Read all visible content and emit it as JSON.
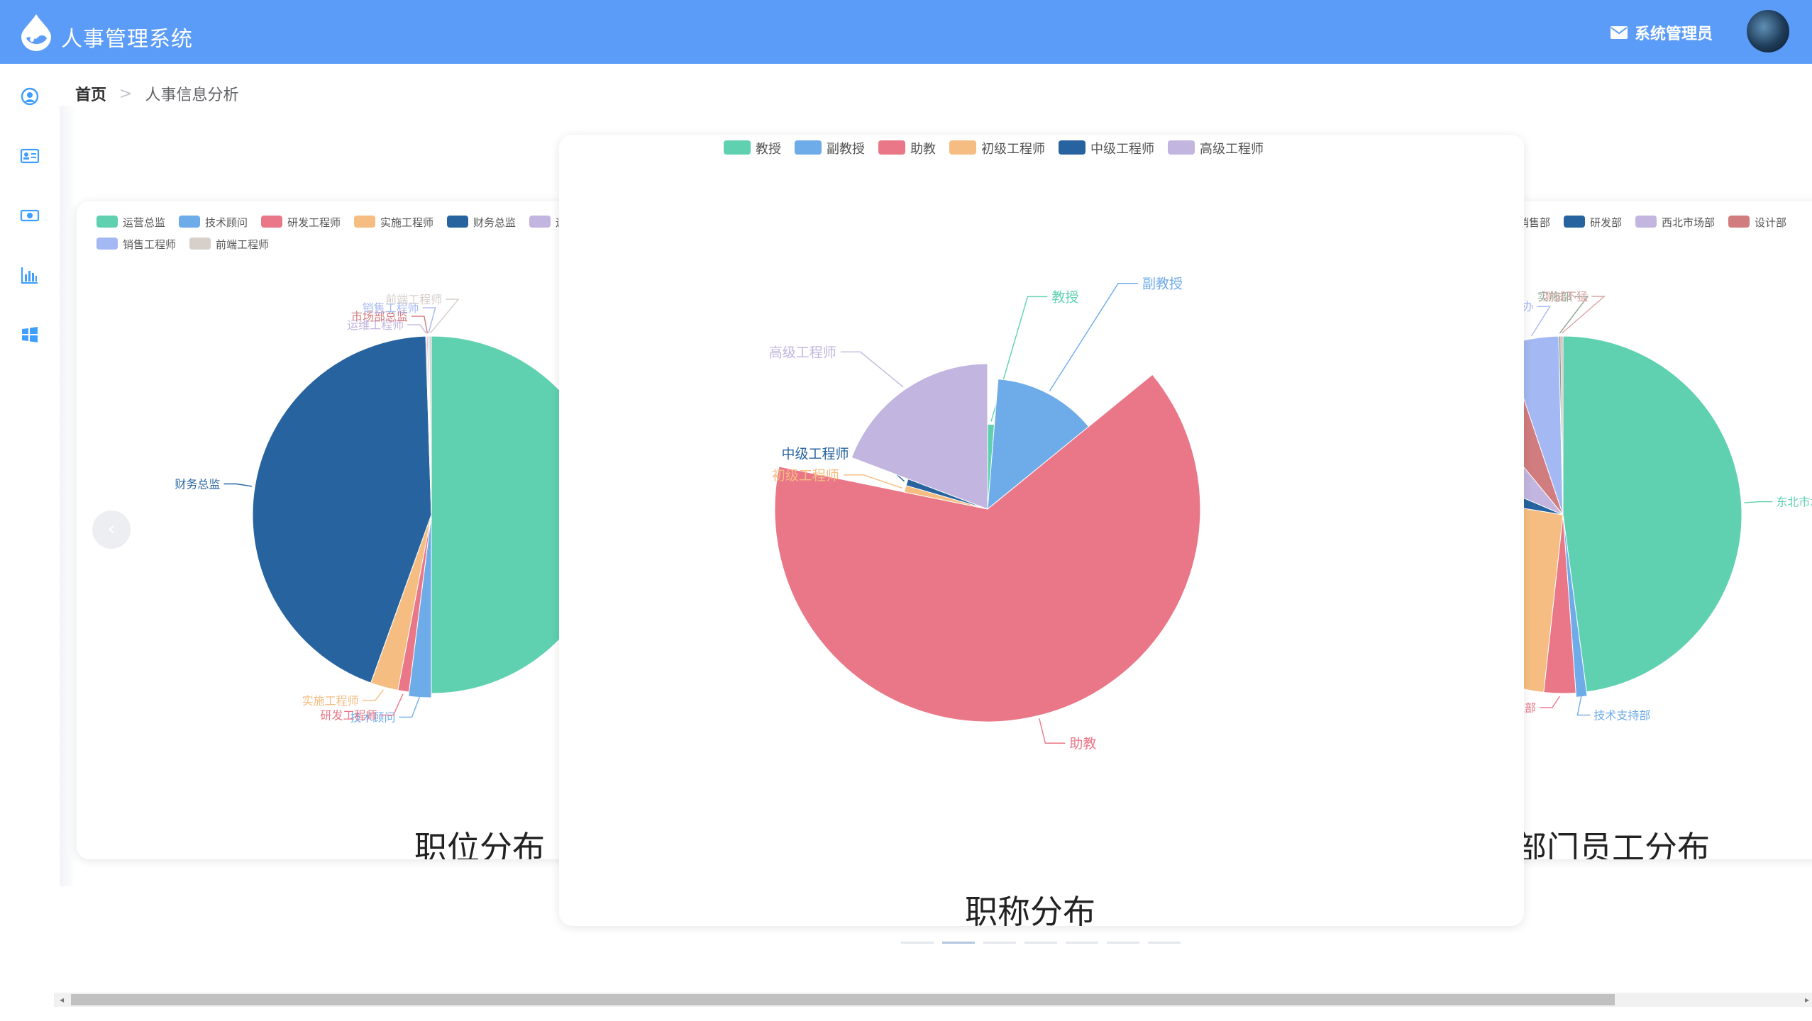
{
  "app": {
    "title": "人事管理系统"
  },
  "user": {
    "name": "系统管理员"
  },
  "breadcrumb": {
    "home": "首页",
    "separator": ">",
    "current": "人事信息分析"
  },
  "carousel": {
    "prev_label": "‹",
    "indicator_count": 7,
    "active_index": 1
  },
  "colors": {
    "header": "#5b9cf8",
    "accent": "#409eff"
  },
  "sidebar": {
    "icons": [
      "user-circle-icon",
      "id-card-icon",
      "money-icon",
      "bar-chart-icon",
      "windows-icon"
    ]
  },
  "chart_data": [
    {
      "type": "pie",
      "title": "职位分布",
      "legend_position": "top-left",
      "legend": [
        "运营总监",
        "技术顾问",
        "研发工程师",
        "实施工程师",
        "财务总监",
        "运维工程师",
        "市场部总监",
        "销售工程师",
        "前端工程师"
      ],
      "categories": [
        "运营总监",
        "技术顾问",
        "研发工程师",
        "实施工程师",
        "财务总监",
        "运维工程师",
        "市场部总监",
        "销售工程师",
        "前端工程师"
      ],
      "values": [
        50,
        2,
        1,
        2.5,
        44,
        0.1,
        0.1,
        0.1,
        0.2
      ],
      "colors": [
        "#5fd1b0",
        "#6eabe9",
        "#ea7787",
        "#f5bd82",
        "#27649f",
        "#c2b5df",
        "#d17c7e",
        "#a4b8f3",
        "#d6cfca"
      ]
    },
    {
      "type": "pie",
      "subtype": "rose",
      "title": "职称分布",
      "legend_position": "top-center",
      "legend": [
        "教授",
        "副教授",
        "助教",
        "初级工程师",
        "中级工程师",
        "高级工程师"
      ],
      "categories": [
        "教授",
        "副教授",
        "助教",
        "初级工程师",
        "中级工程师",
        "高级工程师"
      ],
      "values": [
        0.1,
        1,
        5,
        0.1,
        0.1,
        1.5
      ],
      "colors": [
        "#5fd1b0",
        "#6eabe9",
        "#ea7787",
        "#f5bd82",
        "#27649f",
        "#c2b5df"
      ]
    },
    {
      "type": "pie",
      "title": "部门员工分布",
      "legend_position": "top-left",
      "legend": [
        "东北市场部",
        "技术支持部",
        "运维部",
        "销售部",
        "研发部",
        "西北市场部",
        "设计部",
        "总办",
        "实施部",
        "测试不猛"
      ],
      "categories": [
        "东北市场部",
        "技术支持部",
        "运维部",
        "销售部",
        "研发部",
        "西北市场部",
        "设计部",
        "总办",
        "实施部",
        "测试不猛"
      ],
      "values": [
        50,
        1,
        3,
        27,
        4,
        8,
        6,
        5,
        0.2,
        0.2
      ],
      "colors": [
        "#5fd1b0",
        "#6eabe9",
        "#ea7787",
        "#f5bd82",
        "#27649f",
        "#c2b5df",
        "#d17c7e",
        "#a4b8f3",
        "#8aa48f",
        "#d9a4a4"
      ]
    }
  ]
}
